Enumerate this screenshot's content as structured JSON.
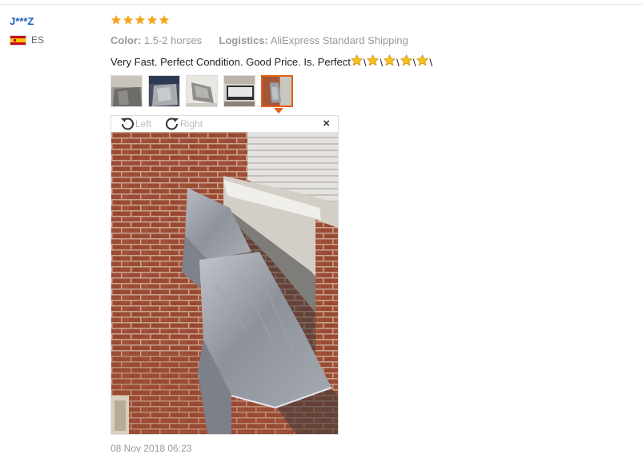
{
  "reviewer": {
    "name": "J***Z",
    "country_code": "ES"
  },
  "rating": {
    "value": 5,
    "max": 5,
    "color": "#f5a623"
  },
  "attributes": {
    "color_label": "Color:",
    "color_value": "1.5-2 horses",
    "logistics_label": "Logistics:",
    "logistics_value": "AliExpress Standard Shipping"
  },
  "review_text": "Very Fast. Perfect Condition. Good Price. Is. Perfect",
  "review_emoji": {
    "icon": "star-emoji-icon",
    "count": 5,
    "separator": "\\"
  },
  "thumbnails": {
    "count": 5,
    "active_index": 4,
    "active_color": "#e35f14"
  },
  "viewer": {
    "rotate_left_label": "Left",
    "rotate_right_label": "Right",
    "close_label": "×"
  },
  "date": "08 Nov 2018 06:23"
}
